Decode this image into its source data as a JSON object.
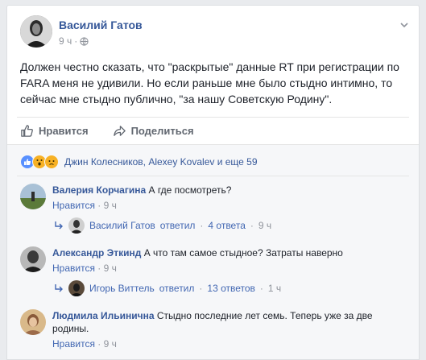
{
  "post": {
    "author": "Василий Гатов",
    "time": "9 ч",
    "dot": "·",
    "privacy_icon": "globe-icon",
    "text": "Должен честно сказать, что \"раскрытые\" данные RT при регистрации по FARA меня не удивили. Но если раньше мне было стыдно интимно, то сейчас мне стыдно публично, \"за нашу Советскую Родину\"."
  },
  "actions": {
    "like": "Нравится",
    "share": "Поделиться"
  },
  "reactions": {
    "icons": [
      "like-icon",
      "wow-icon",
      "sad-icon"
    ],
    "summary": "Джин Колесников, Alexey Kovalev и еще 59"
  },
  "colors": {
    "link": "#365899",
    "action_link": "#4267b2",
    "like_blue": "#5890ff",
    "muted": "#90949c"
  },
  "comments": [
    {
      "name": "Валерия Корчагина",
      "text": "А где посмотреть?",
      "like": "Нравится",
      "dot": "·",
      "time": "9 ч",
      "reply": {
        "author": "Василий Гатов",
        "text": "ответил",
        "sep1": "·",
        "count": "4 ответа",
        "sep2": "·",
        "time": "9 ч"
      }
    },
    {
      "name": "Александр Эткинд",
      "text": "А что там самое стыдное? Затраты наверно",
      "like": "Нравится",
      "dot": "·",
      "time": "9 ч",
      "reply": {
        "author": "Игорь Виттель",
        "text": "ответил",
        "sep1": "·",
        "count": "13 ответов",
        "sep2": "·",
        "time": "1 ч"
      }
    },
    {
      "name": "Людмила Ильинична",
      "text": "Стыдно последние лет семь. Теперь уже за две родины.",
      "like": "Нравится",
      "dot": "·",
      "time": "9 ч"
    }
  ]
}
